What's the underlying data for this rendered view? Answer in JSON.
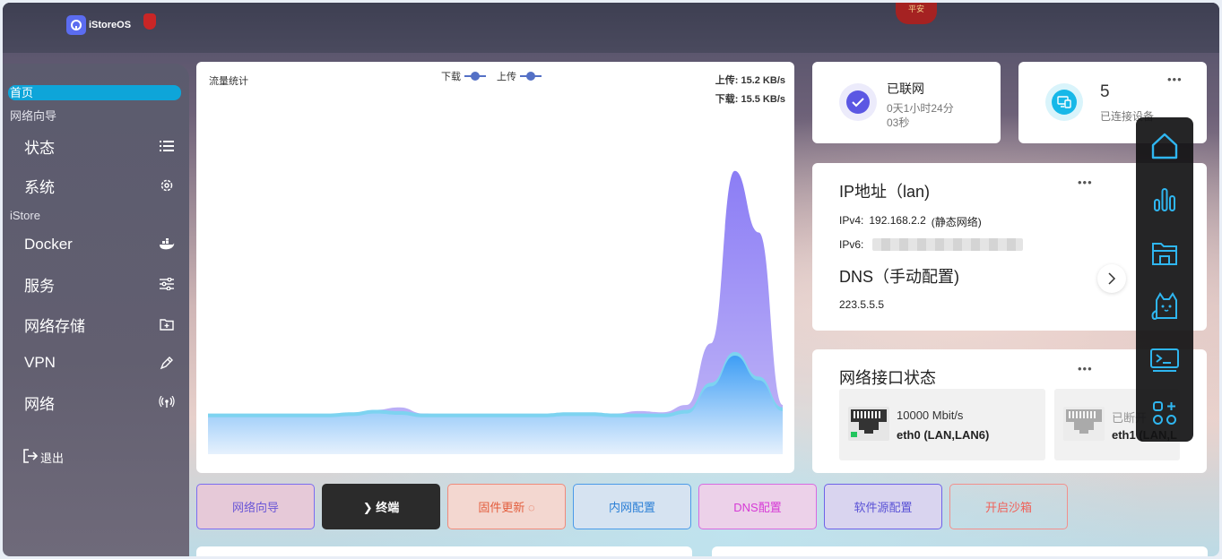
{
  "brand": {
    "name": "iStoreOS",
    "lantern_text": "平安"
  },
  "sidebar": {
    "home": "首页",
    "section_wizard": "网络向导",
    "items_top": [
      {
        "label": "状态",
        "icon": "list-icon"
      },
      {
        "label": "系统",
        "icon": "gear-icon"
      }
    ],
    "section_istore": "iStore",
    "items_bottom": [
      {
        "label": "Docker",
        "icon": "docker-icon"
      },
      {
        "label": "服务",
        "icon": "sliders-icon"
      },
      {
        "label": "网络存储",
        "icon": "folder-plus-icon"
      },
      {
        "label": "VPN",
        "icon": "pen-icon"
      },
      {
        "label": "网络",
        "icon": "antenna-icon"
      }
    ],
    "logout": "退出"
  },
  "traffic": {
    "title": "流量统计",
    "legend_download": "下载",
    "legend_upload": "上传",
    "upload_rate": "上传: 15.2 KB/s",
    "download_rate": "下载: 15.5 KB/s"
  },
  "chart_data": {
    "type": "area",
    "title": "流量统计",
    "series": [
      {
        "name": "下载",
        "values": [
          30,
          30,
          30,
          30,
          30,
          30,
          31,
          33,
          32,
          30,
          30,
          30,
          30,
          30,
          30,
          31,
          31,
          30,
          30,
          30,
          33,
          55,
          80,
          60,
          35
        ]
      },
      {
        "name": "上传",
        "values": [
          30,
          30,
          30,
          31,
          31,
          31,
          32,
          36,
          38,
          33,
          32,
          32,
          32,
          32,
          32,
          31,
          30,
          33,
          35,
          34,
          40,
          90,
          230,
          180,
          40
        ]
      }
    ],
    "colors": {
      "download": "#7dd3f0",
      "upload": "#8b7df5",
      "download_base": "#7eb6f5"
    }
  },
  "quick_actions": [
    {
      "label": "网络向导",
      "color": "#6b57d6",
      "bg": "#e6c9d8",
      "border": "#7b6cf0"
    },
    {
      "label": "❯ 终端",
      "color": "#ffffff",
      "bg": "#2b2b2b",
      "border": "#2b2b2b"
    },
    {
      "label": "固件更新 ◌",
      "color": "#e35d3d",
      "bg": "#f3d7d0",
      "border": "#f08a7a"
    },
    {
      "label": "内网配置",
      "color": "#2b7fd6",
      "bg": "#d6e3f1",
      "border": "#4a9ae8"
    },
    {
      "label": "DNS配置",
      "color": "#d63ad6",
      "bg": "#ecd1e9",
      "border": "#d86ae0"
    },
    {
      "label": "软件源配置",
      "color": "#5a52d6",
      "bg": "#d9d4ef",
      "border": "#6e62e8"
    },
    {
      "label": "开启沙箱",
      "color": "#f0625a",
      "bg": "transparent",
      "border": "#f2908c"
    }
  ],
  "network_status": {
    "title": "已联网",
    "uptime_line1": "0天1小时24分",
    "uptime_line2": "03秒"
  },
  "devices": {
    "count": "5",
    "label": "已连接设备",
    "more": "•••"
  },
  "ip_card": {
    "title": "IP地址（lan)",
    "ipv4_label": "IPv4:",
    "ipv4_value": "192.168.2.2",
    "ipv4_note": "(静态网络)",
    "ipv6_label": "IPv6:",
    "dns_title": "DNS（手动配置)",
    "dns_value": "223.5.5.5",
    "more": "•••"
  },
  "interfaces": {
    "title": "网络接口状态",
    "ports": [
      {
        "speed": "10000 Mbit/s",
        "name": "eth0 (LAN,LAN6)"
      },
      {
        "speed": "已断开",
        "name": "eth1 (LAN,L"
      }
    ],
    "more": "•••"
  },
  "dock": {
    "icons": [
      "home-icon",
      "chart-icon",
      "files-icon",
      "cat-icon",
      "terminal-icon",
      "apps-icon"
    ]
  }
}
